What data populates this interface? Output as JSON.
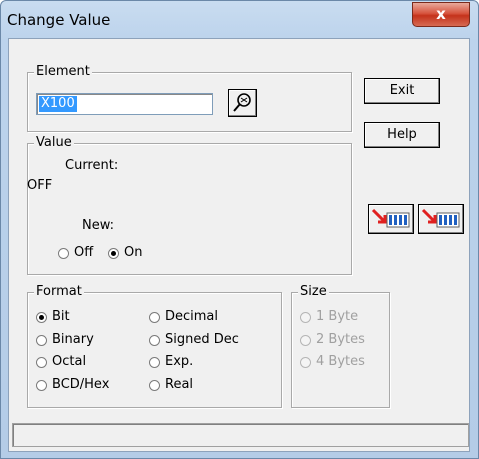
{
  "window": {
    "title": "Change Value",
    "close_label": "x"
  },
  "element": {
    "group_label": "Element",
    "value": "X100"
  },
  "value": {
    "group_label": "Value",
    "current_label": "Current:",
    "current_value": "OFF",
    "new_label": "New:",
    "off_label": "Off",
    "on_label": "On",
    "selected": "On"
  },
  "buttons": {
    "exit": "Exit",
    "help": "Help"
  },
  "format": {
    "group_label": "Format",
    "options": [
      "Bit",
      "Binary",
      "Octal",
      "BCD/Hex",
      "Decimal",
      "Signed Dec",
      "Exp.",
      "Real"
    ],
    "selected": "Bit"
  },
  "size": {
    "group_label": "Size",
    "options": [
      "1 Byte",
      "2 Bytes",
      "4 Bytes"
    ],
    "enabled": false
  },
  "status_bar": {
    "text": ""
  },
  "icons": {
    "search": "search-zoom-icon",
    "write_a": "write-arrow-icon",
    "write_b": "write-arrow-icon"
  },
  "colors": {
    "selection": "#3399ff",
    "title_bar": "#bcd3ec",
    "close_button": "#c4321b",
    "icon_red": "#e02020"
  }
}
